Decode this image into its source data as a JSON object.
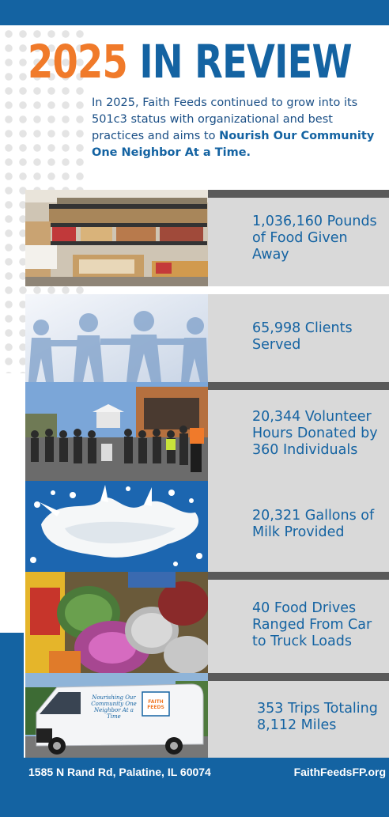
{
  "header": {
    "year": "2025",
    "title_rest": "IN REVIEW",
    "intro_text": "In 2025, Faith Feeds continued to grow into its 501c3 status with organizational and best practices and aims to ",
    "intro_bold": "Nourish Our Community One Neighbor At a Time."
  },
  "stats": [
    {
      "text": "1,036,160 Pounds of Food Given Away",
      "photo_icon": "food-pantry-shelves-photo"
    },
    {
      "text": "65,998 Clients Served",
      "photo_icon": "paper-people-chain-photo"
    },
    {
      "text": "20,344 Volunteer Hours Donated by 360 Individuals",
      "photo_icon": "volunteer-group-photo"
    },
    {
      "text": "20,321 Gallons of Milk Provided",
      "photo_icon": "milk-splash-photo"
    },
    {
      "text": "40 Food Drives Ranged From Car to Truck Loads",
      "photo_icon": "canned-goods-photo"
    },
    {
      "text": "353 Trips Totaling 8,112 Miles",
      "photo_icon": "delivery-van-photo"
    }
  ],
  "van": {
    "slogan": "Nourishing Our Community One Neighbor At a Time",
    "logo_text": "FAITH FEEDS"
  },
  "footer": {
    "address": "1585 N Rand Rd, Palatine, IL 60074",
    "website": "FaithFeedsFP.org"
  },
  "colors": {
    "brand_blue": "#1463a2",
    "accent_orange": "#f07a2a",
    "panel_gray": "#d9d9d9",
    "strip_gray": "#5a5a5a"
  }
}
